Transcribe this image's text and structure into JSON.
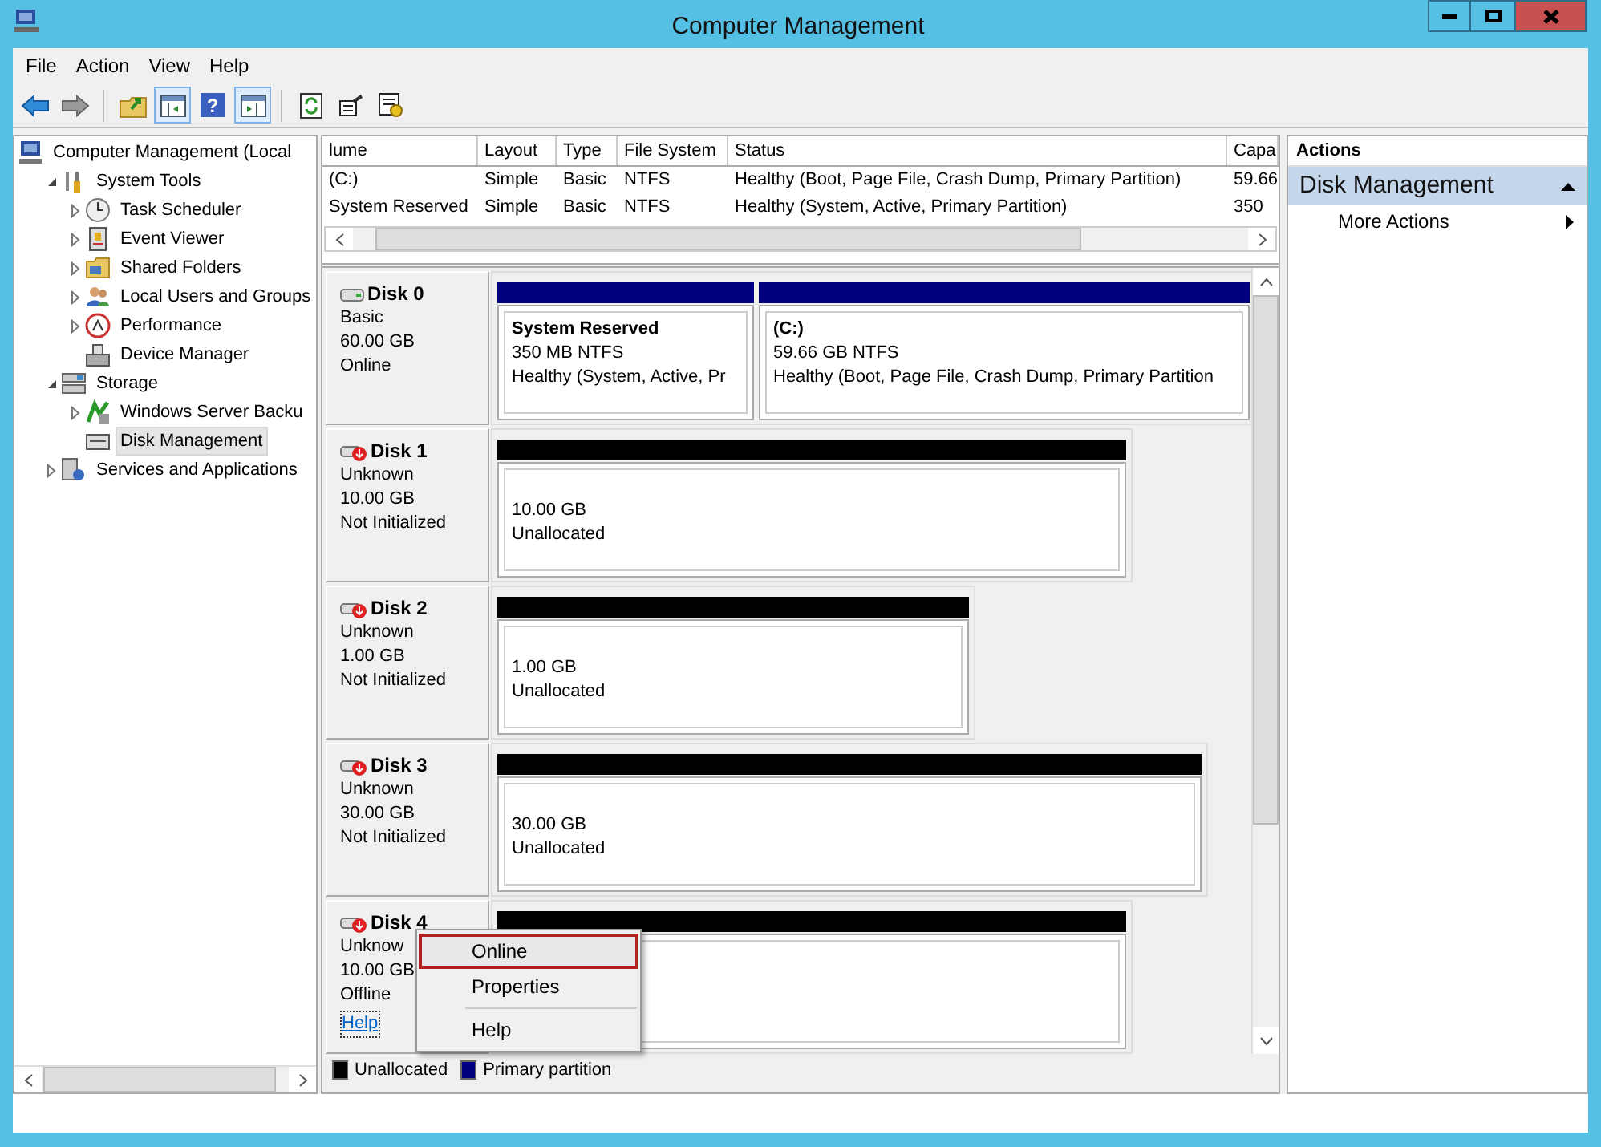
{
  "window": {
    "title": "Computer Management"
  },
  "menu_bar": [
    "File",
    "Action",
    "View",
    "Help"
  ],
  "toolbar": [
    {
      "kind": "back",
      "pressed": false
    },
    {
      "kind": "forward",
      "pressed": false
    },
    {
      "kind": "separator"
    },
    {
      "kind": "up",
      "pressed": false
    },
    {
      "kind": "console-tree",
      "pressed": true
    },
    {
      "kind": "help",
      "glyph": "?",
      "pressed": false
    },
    {
      "kind": "action-pane",
      "pressed": true
    },
    {
      "kind": "separator"
    },
    {
      "kind": "refresh",
      "pressed": false
    },
    {
      "kind": "properties",
      "pressed": false
    },
    {
      "kind": "settings",
      "pressed": false
    }
  ],
  "tree": [
    {
      "label": "Computer Management (Local",
      "selected": false,
      "children": [
        {
          "label": "System Tools",
          "expanded": true,
          "selected": false,
          "children": [
            {
              "label": "Task Scheduler",
              "expanded": false,
              "selected": false
            },
            {
              "label": "Event Viewer",
              "expanded": false,
              "selected": false
            },
            {
              "label": "Shared Folders",
              "expanded": false,
              "selected": false
            },
            {
              "label": "Local Users and Groups",
              "expanded": false,
              "selected": false
            },
            {
              "label": "Performance",
              "expanded": false,
              "selected": false
            },
            {
              "label": "Device Manager",
              "selected": false
            }
          ]
        },
        {
          "label": "Storage",
          "expanded": true,
          "selected": false,
          "children": [
            {
              "label": "Windows Server Backu",
              "expanded": false,
              "selected": false
            },
            {
              "label": "Disk Management",
              "selected": true
            }
          ]
        },
        {
          "label": "Services and Applications",
          "expanded": false,
          "selected": false
        }
      ]
    }
  ],
  "volume_table": {
    "columns": [
      "lume",
      "Layout",
      "Type",
      "File System",
      "Status",
      "Capa"
    ],
    "rows": [
      [
        "(C:)",
        "Simple",
        "Basic",
        "NTFS",
        "Healthy (Boot, Page File, Crash Dump, Primary Partition)",
        "59.66"
      ],
      [
        "System Reserved",
        "Simple",
        "Basic",
        "NTFS",
        "Healthy (System, Active, Primary Partition)",
        "350"
      ]
    ]
  },
  "disks": [
    {
      "name": "Disk 0",
      "alert": false,
      "lines": [
        "Basic",
        "60.00 GB",
        "Online"
      ],
      "partitions": [
        {
          "kind": "primary",
          "title": "System Reserved",
          "lines": [
            "350 MB NTFS",
            "Healthy (System, Active, Pr"
          ]
        },
        {
          "kind": "primary",
          "title": "(C:)",
          "lines": [
            "59.66 GB NTFS",
            "Healthy (Boot, Page File, Crash Dump, Primary Partition"
          ]
        }
      ]
    },
    {
      "name": "Disk 1",
      "alert": true,
      "lines": [
        "Unknown",
        "10.00 GB",
        "Not Initialized"
      ],
      "partitions": [
        {
          "kind": "unallocated",
          "lines": [
            "10.00 GB",
            "Unallocated"
          ]
        }
      ]
    },
    {
      "name": "Disk 2",
      "alert": true,
      "lines": [
        "Unknown",
        "1.00 GB",
        "Not Initialized"
      ],
      "partitions": [
        {
          "kind": "unallocated",
          "lines": [
            "1.00 GB",
            "Unallocated"
          ]
        }
      ]
    },
    {
      "name": "Disk 3",
      "alert": true,
      "lines": [
        "Unknown",
        "30.00 GB",
        "Not Initialized"
      ],
      "partitions": [
        {
          "kind": "unallocated",
          "lines": [
            "30.00 GB",
            "Unallocated"
          ]
        }
      ]
    },
    {
      "name": "Disk 4",
      "alert": true,
      "lines": [
        "Unknow",
        "10.00 GB",
        "Offline"
      ],
      "link": "Help",
      "partitions": [
        {
          "kind": "unallocated"
        }
      ]
    }
  ],
  "legend": [
    {
      "kind": "unallocated",
      "label": "Unallocated"
    },
    {
      "kind": "primary",
      "label": "Primary partition"
    }
  ],
  "context_menu": [
    {
      "kind": "item",
      "label": "Online",
      "selected": true
    },
    {
      "kind": "item",
      "label": "Properties",
      "selected": false
    },
    {
      "kind": "separator"
    },
    {
      "kind": "item",
      "label": "Help",
      "selected": false
    }
  ],
  "actions": {
    "header": "Actions",
    "section": {
      "label": "Disk Management",
      "expanded": true
    },
    "items": [
      "More Actions"
    ]
  }
}
